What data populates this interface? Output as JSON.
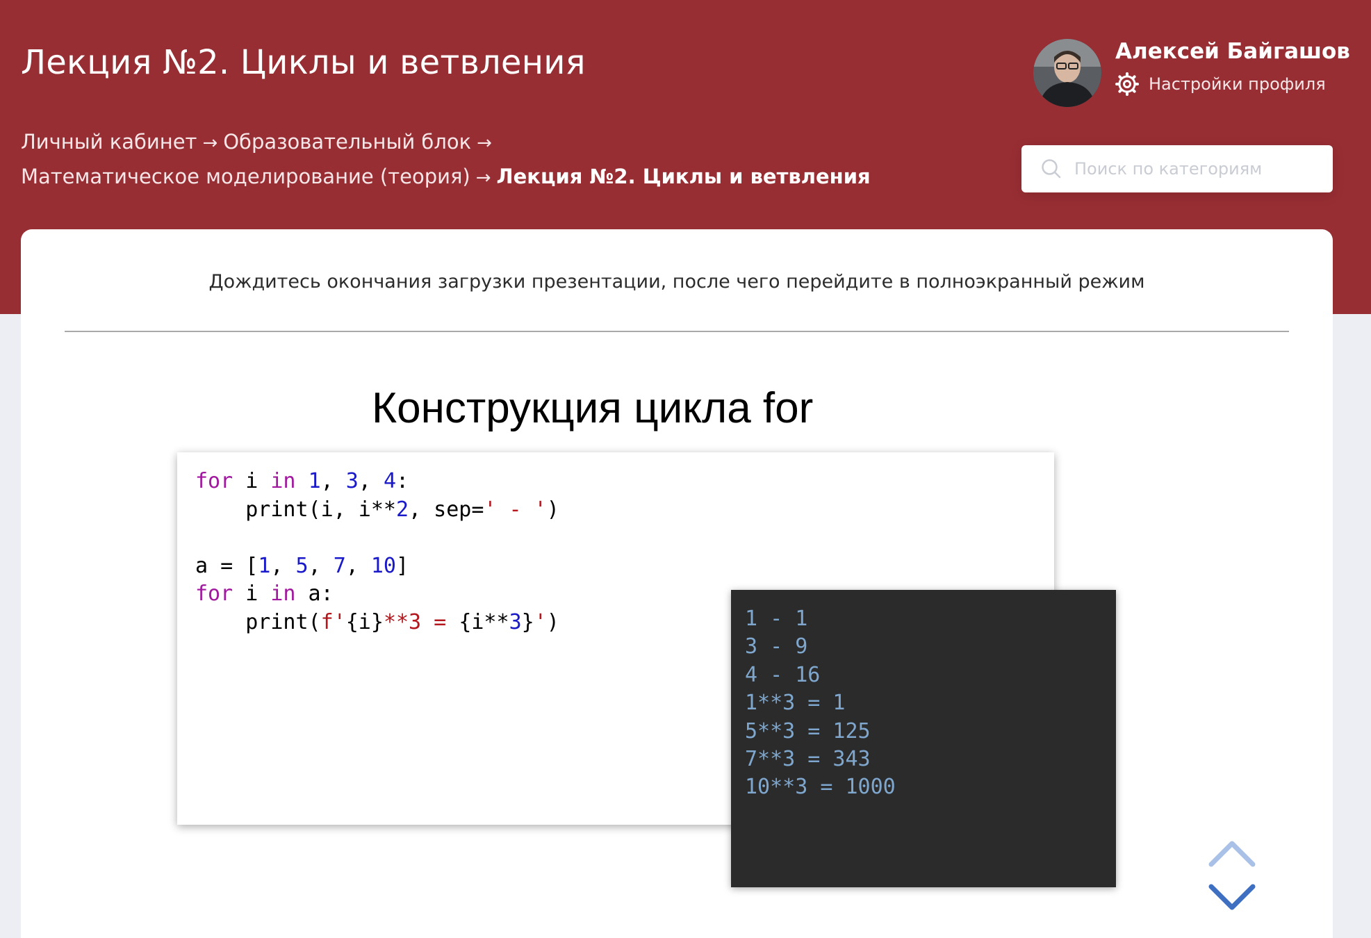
{
  "header": {
    "title": "Лекция №2. Циклы и ветвления",
    "background_color": "#972e34",
    "breadcrumb": [
      "Личный кабинет",
      "Образовательный блок",
      "Математическое моделирование (теория)",
      "Лекция №2. Циклы и ветвления"
    ],
    "breadcrumb_separator": "→"
  },
  "user": {
    "name": "Алексей Байгашов",
    "settings_label": "Настройки профиля",
    "avatar_icon": "user-avatar-photo",
    "settings_icon": "gear-icon"
  },
  "search": {
    "placeholder": "Поиск по категориям",
    "value": "",
    "icon": "search-icon"
  },
  "content": {
    "notice": "Дождитесь окончания загрузки презентации, после чего перейдите в полноэкранный режим",
    "slide": {
      "title": "Конструкция цикла for",
      "code_lines": [
        "for i in 1, 3, 4:",
        "    print(i, i**2, sep=' - ')",
        "",
        "a = [1, 5, 7, 10]",
        "for i in a:",
        "    print(f'{i}**3 = {i**3}')"
      ],
      "output_lines": [
        "1 - 1",
        "3 - 9",
        "4 - 16",
        "1**3 = 1",
        "5**3 = 125",
        "7**3 = 343",
        "10**3 = 1000"
      ]
    },
    "nav": {
      "prev_icon": "chevron-up-icon",
      "next_icon": "chevron-down-icon",
      "prev_color": "#a9c1e6",
      "next_color": "#3f6fc0"
    }
  }
}
